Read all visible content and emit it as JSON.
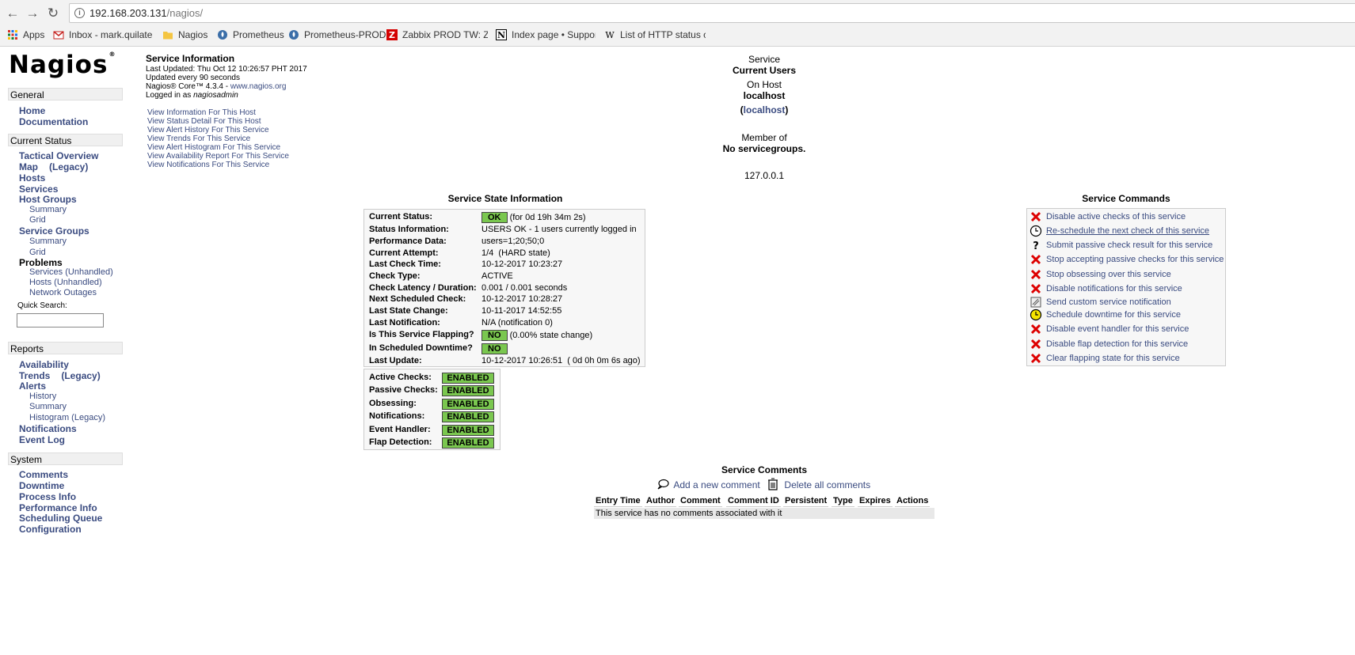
{
  "browser": {
    "url_host": "192.168.203.131",
    "url_path": "/nagios/",
    "bookmarks": [
      {
        "label": "Apps",
        "icon": "apps-grid-icon"
      },
      {
        "label": "Inbox - mark.quilates",
        "icon": "gmail-icon"
      },
      {
        "label": "Nagios",
        "icon": "folder-icon"
      },
      {
        "label": "Prometheus",
        "icon": "prometheus-icon"
      },
      {
        "label": "Prometheus-PROD",
        "icon": "prometheus-icon"
      },
      {
        "label": "Zabbix PROD TW: Za",
        "icon": "zabbix-icon"
      },
      {
        "label": "Index page • Support",
        "icon": "notion-icon"
      },
      {
        "label": "List of HTTP status co",
        "icon": "wikipedia-icon"
      }
    ]
  },
  "logo": {
    "text": "Nagios",
    "mark": "®"
  },
  "sidebar": {
    "general": {
      "title": "General",
      "items": [
        "Home",
        "Documentation"
      ]
    },
    "current_status": {
      "title": "Current Status",
      "tactical": "Tactical Overview",
      "map": "Map",
      "map_legacy": "(Legacy)",
      "hosts": "Hosts",
      "services": "Services",
      "host_groups": "Host Groups",
      "hg_summary": "Summary",
      "hg_grid": "Grid",
      "service_groups": "Service Groups",
      "sg_summary": "Summary",
      "sg_grid": "Grid",
      "problems": "Problems",
      "prob_services": "Services (Unhandled)",
      "prob_hosts": "Hosts (Unhandled)",
      "prob_outages": "Network Outages",
      "quick_search": "Quick Search:"
    },
    "reports": {
      "title": "Reports",
      "availability": "Availability",
      "trends": "Trends",
      "trends_legacy": "(Legacy)",
      "alerts": "Alerts",
      "history": "History",
      "summary": "Summary",
      "histogram": "Histogram (Legacy)",
      "notifications": "Notifications",
      "event_log": "Event Log"
    },
    "system": {
      "title": "System",
      "items": [
        "Comments",
        "Downtime",
        "Process Info",
        "Performance Info",
        "Scheduling Queue",
        "Configuration"
      ]
    }
  },
  "info": {
    "title": "Service Information",
    "last_updated": "Last Updated: Thu Oct 12 10:26:57 PHT 2017",
    "interval": "Updated every 90 seconds",
    "version": "Nagios® Core™ 4.3.4 - ",
    "site": "www.nagios.org",
    "logged_prefix": "Logged in as ",
    "user": "nagiosadmin",
    "links": [
      "View Information For This Host",
      "View Status Detail For This Host",
      "View Alert History For This Service",
      "View Trends For This Service",
      "View Alert Histogram For This Service",
      "View Availability Report For This Service",
      "View Notifications For This Service"
    ]
  },
  "service_header": {
    "service_label": "Service",
    "service_name": "Current Users",
    "on_host": "On Host",
    "host": "localhost",
    "host_alias": "localhost",
    "member_of": "Member of",
    "groups": "No servicegroups.",
    "address": "127.0.0.1"
  },
  "state": {
    "title": "Service State Information",
    "rows": [
      {
        "k": "Current Status:",
        "badge": "OK",
        "v": "(for 0d 19h 34m 2s)"
      },
      {
        "k": "Status Information:",
        "v": "USERS OK - 1 users currently logged in"
      },
      {
        "k": "Performance Data:",
        "v": "users=1;20;50;0"
      },
      {
        "k": "Current Attempt:",
        "v": "1/4  (HARD state)"
      },
      {
        "k": "Last Check Time:",
        "v": "10-12-2017 10:23:27"
      },
      {
        "k": "Check Type:",
        "v": "ACTIVE"
      },
      {
        "k": "Check Latency / Duration:",
        "v": "0.001 / 0.001 seconds"
      },
      {
        "k": "Next Scheduled Check:",
        "v": "10-12-2017 10:28:27"
      },
      {
        "k": "Last State Change:",
        "v": "10-11-2017 14:52:55"
      },
      {
        "k": "Last Notification:",
        "v": "N/A (notification 0)"
      },
      {
        "k": "Is This Service Flapping?",
        "badge": "NO",
        "v": "(0.00% state change)"
      },
      {
        "k": "In Scheduled Downtime?",
        "badge": "NO",
        "v": ""
      },
      {
        "k": "Last Update:",
        "v": "10-12-2017 10:26:51  ( 0d 0h 0m 6s ago)"
      }
    ],
    "checks": [
      {
        "k": "Active Checks:",
        "v": "ENABLED"
      },
      {
        "k": "Passive Checks:",
        "v": "ENABLED"
      },
      {
        "k": "Obsessing:",
        "v": "ENABLED"
      },
      {
        "k": "Notifications:",
        "v": "ENABLED"
      },
      {
        "k": "Event Handler:",
        "v": "ENABLED"
      },
      {
        "k": "Flap Detection:",
        "v": "ENABLED"
      }
    ]
  },
  "commands": {
    "title": "Service Commands",
    "items": [
      {
        "label": "Disable active checks of this service",
        "icon": "disable-x-icon"
      },
      {
        "label": "Re-schedule the next check of this service",
        "icon": "clock-icon"
      },
      {
        "label": "Submit passive check result for this service",
        "icon": "question-icon"
      },
      {
        "label": "Stop accepting passive checks for this service",
        "icon": "disable-x-icon"
      },
      {
        "label": "Stop obsessing over this service",
        "icon": "disable-x-icon"
      },
      {
        "label": "Disable notifications for this service",
        "icon": "disable-x-icon"
      },
      {
        "label": "Send custom service notification",
        "icon": "notify-icon"
      },
      {
        "label": "Schedule downtime for this service",
        "icon": "downtime-clock-icon"
      },
      {
        "label": "Disable event handler for this service",
        "icon": "disable-x-icon"
      },
      {
        "label": "Disable flap detection for this service",
        "icon": "disable-x-icon"
      },
      {
        "label": "Clear flapping state for this service",
        "icon": "disable-x-icon"
      }
    ]
  },
  "comments": {
    "title": "Service Comments",
    "add": "Add a new comment",
    "delete": "Delete all comments",
    "headers": [
      "Entry Time",
      "Author",
      "Comment",
      "Comment ID",
      "Persistent",
      "Type",
      "Expires",
      "Actions"
    ],
    "empty": "This service has no comments associated with it"
  },
  "colors": {
    "link": "#3a4b80",
    "ok_green": "#7ac74f",
    "disable_red": "#dd0000"
  }
}
